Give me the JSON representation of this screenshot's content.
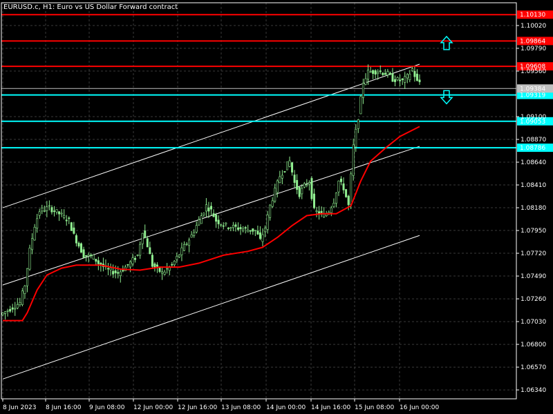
{
  "header": {
    "symbol_title": "EURUSD.c, H1:  Euro vs US Dollar Forward contract"
  },
  "colors": {
    "background": "#000000",
    "grid": "#3a3a3a",
    "candle_up": "#90EE90",
    "candle_down": "#90EE90",
    "moving_average": "#FF0000",
    "channel": "#FFFFFF",
    "resistance": "#FF0000",
    "support": "#00FFFF",
    "current_price": "#C0C0C0",
    "text": "#FFFFFF"
  },
  "chart_data": {
    "type": "candlestick",
    "symbol": "EURUSD.c",
    "timeframe": "H1",
    "ylim": [
      1.0625,
      1.1025
    ],
    "grid": true,
    "y_ticks": [
      "1.10020",
      "1.09790",
      "1.09560",
      "1.09100",
      "1.08870",
      "1.08640",
      "1.08410",
      "1.08180",
      "1.07950",
      "1.07720",
      "1.07490",
      "1.07260",
      "1.07030",
      "1.06800",
      "1.06570",
      "1.06340"
    ],
    "x_ticks": [
      "8 Jun 2023",
      "8 Jun 16:00",
      "9 Jun 08:00",
      "12 Jun 00:00",
      "12 Jun 16:00",
      "13 Jun 08:00",
      "14 Jun 00:00",
      "14 Jun 16:00",
      "15 Jun 08:00",
      "16 Jun 00:00"
    ],
    "current_price": {
      "label": "1.09384",
      "value": 1.09384
    },
    "horizontal_levels": [
      {
        "kind": "resistance",
        "label": "1.10130",
        "value": 1.1013
      },
      {
        "kind": "resistance",
        "label": "1.09864",
        "value": 1.09864
      },
      {
        "kind": "resistance",
        "label": "1.09608",
        "value": 1.09608
      },
      {
        "kind": "support",
        "label": "1.09319",
        "value": 1.09319
      },
      {
        "kind": "support",
        "label": "1.09053",
        "value": 1.09053
      },
      {
        "kind": "support",
        "label": "1.08786",
        "value": 1.08786
      }
    ],
    "price_path": [
      [
        0,
        1.071
      ],
      [
        4,
        1.0716
      ],
      [
        8,
        1.0722
      ],
      [
        10,
        1.074
      ],
      [
        12,
        1.0775
      ],
      [
        14,
        1.08
      ],
      [
        16,
        1.0815
      ],
      [
        20,
        1.0818
      ],
      [
        24,
        1.0812
      ],
      [
        28,
        1.0805
      ],
      [
        30,
        1.079
      ],
      [
        34,
        1.077
      ],
      [
        38,
        1.0768
      ],
      [
        40,
        1.0762
      ],
      [
        44,
        1.0755
      ],
      [
        48,
        1.0752
      ],
      [
        52,
        1.076
      ],
      [
        56,
        1.077
      ],
      [
        58,
        1.0795
      ],
      [
        60,
        1.078
      ],
      [
        62,
        1.076
      ],
      [
        66,
        1.0752
      ],
      [
        70,
        1.076
      ],
      [
        74,
        1.0775
      ],
      [
        78,
        1.079
      ],
      [
        82,
        1.081
      ],
      [
        84,
        1.082
      ],
      [
        86,
        1.0815
      ],
      [
        88,
        1.0805
      ],
      [
        92,
        1.08
      ],
      [
        96,
        1.0798
      ],
      [
        100,
        1.0796
      ],
      [
        104,
        1.0795
      ],
      [
        106,
        1.0785
      ],
      [
        108,
        1.0798
      ],
      [
        110,
        1.082
      ],
      [
        114,
        1.085
      ],
      [
        118,
        1.0865
      ],
      [
        120,
        1.0843
      ],
      [
        122,
        1.0832
      ],
      [
        124,
        1.084
      ],
      [
        126,
        1.0845
      ],
      [
        128,
        1.0815
      ],
      [
        132,
        1.081
      ],
      [
        134,
        1.0815
      ],
      [
        136,
        1.0825
      ],
      [
        138,
        1.0845
      ],
      [
        140,
        1.0838
      ],
      [
        142,
        1.082
      ],
      [
        144,
        1.088
      ],
      [
        146,
        1.091
      ],
      [
        148,
        1.0945
      ],
      [
        150,
        1.0955
      ],
      [
        154,
        1.0956
      ],
      [
        158,
        1.0953
      ],
      [
        160,
        1.0948
      ],
      [
        164,
        1.0946
      ],
      [
        166,
        1.095
      ],
      [
        168,
        1.0958
      ],
      [
        170,
        1.0945
      ]
    ],
    "moving_average": [
      [
        0,
        1.0704
      ],
      [
        8,
        1.0704
      ],
      [
        10,
        1.0712
      ],
      [
        14,
        1.0735
      ],
      [
        18,
        1.075
      ],
      [
        24,
        1.0757
      ],
      [
        30,
        1.076
      ],
      [
        40,
        1.076
      ],
      [
        48,
        1.0756
      ],
      [
        56,
        1.0755
      ],
      [
        64,
        1.0758
      ],
      [
        72,
        1.0758
      ],
      [
        80,
        1.0762
      ],
      [
        90,
        1.077
      ],
      [
        100,
        1.0774
      ],
      [
        106,
        1.0778
      ],
      [
        112,
        1.0788
      ],
      [
        118,
        1.08
      ],
      [
        124,
        1.081
      ],
      [
        130,
        1.0812
      ],
      [
        136,
        1.0812
      ],
      [
        142,
        1.082
      ],
      [
        146,
        1.0845
      ],
      [
        150,
        1.0865
      ],
      [
        156,
        1.0878
      ],
      [
        162,
        1.089
      ],
      [
        170,
        1.09
      ]
    ],
    "channel_lines": [
      {
        "name": "upper",
        "from": [
          0,
          1.0818
        ],
        "to": [
          170,
          1.0963
        ]
      },
      {
        "name": "middle",
        "from": [
          0,
          1.074
        ],
        "to": [
          170,
          1.088
        ]
      },
      {
        "name": "lower",
        "from": [
          0,
          1.0645
        ],
        "to": [
          170,
          1.079
        ]
      }
    ],
    "arrows": [
      {
        "kind": "up",
        "value": 1.0984
      },
      {
        "kind": "down",
        "value": 1.093
      }
    ]
  }
}
